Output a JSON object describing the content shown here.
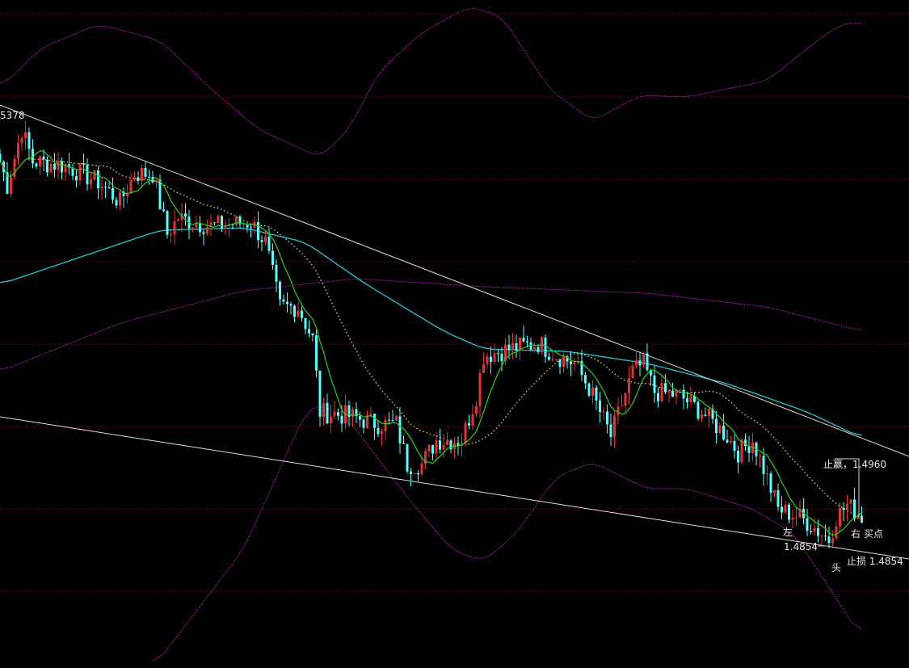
{
  "chart_data": {
    "type": "candlestick",
    "title": "",
    "xlabel": "",
    "ylabel": "",
    "xlim": [
      0,
      250
    ],
    "ylim": [
      1.4705,
      1.5532
    ],
    "grid": true,
    "grid_prices": [
      1.5515,
      1.5412,
      1.531,
      1.5208,
      1.5106,
      1.5004,
      1.4902,
      1.48
    ],
    "colors": {
      "up": "#e83030",
      "down": "#54ffff",
      "grid": "#7a1020",
      "fast_ma": "#1ed21e",
      "slow_ma": "#f0f060",
      "long_ma": "#20c8d8",
      "bands": "#c020c0",
      "trend": "#e0e0e0"
    },
    "close_path": [
      [
        0,
        1.5332
      ],
      [
        2,
        1.5302
      ],
      [
        6,
        1.5372
      ],
      [
        9,
        1.5332
      ],
      [
        18,
        1.5327
      ],
      [
        27,
        1.5307
      ],
      [
        33,
        1.5282
      ],
      [
        37,
        1.5317
      ],
      [
        42,
        1.5317
      ],
      [
        46,
        1.5242
      ],
      [
        49,
        1.5262
      ],
      [
        58,
        1.5252
      ],
      [
        69,
        1.5257
      ],
      [
        73,
        1.5232
      ],
      [
        77,
        1.5152
      ],
      [
        82,
        1.5152
      ],
      [
        86,
        1.5112
      ],
      [
        88,
        1.5022
      ],
      [
        96,
        1.5017
      ],
      [
        104,
        1.5007
      ],
      [
        109,
        1.5007
      ],
      [
        112,
        1.4957
      ],
      [
        116,
        1.4957
      ],
      [
        120,
        1.4987
      ],
      [
        127,
        1.4987
      ],
      [
        131,
        1.5042
      ],
      [
        133,
        1.5092
      ],
      [
        142,
        1.5102
      ],
      [
        148,
        1.5107
      ],
      [
        153,
        1.5092
      ],
      [
        158,
        1.5082
      ],
      [
        162,
        1.5052
      ],
      [
        166,
        1.5012
      ],
      [
        168,
        1.4992
      ],
      [
        171,
        1.5032
      ],
      [
        174,
        1.5072
      ],
      [
        177,
        1.5082
      ],
      [
        180,
        1.5047
      ],
      [
        187,
        1.5042
      ],
      [
        193,
        1.5022
      ],
      [
        200,
        1.4992
      ],
      [
        203,
        1.4972
      ],
      [
        207,
        1.4987
      ],
      [
        210,
        1.4952
      ],
      [
        214,
        1.4902
      ],
      [
        220,
        1.4892
      ],
      [
        223,
        1.4882
      ],
      [
        228,
        1.4864
      ],
      [
        230,
        1.4892
      ],
      [
        233,
        1.4907
      ],
      [
        237,
        1.4892
      ]
    ],
    "series": [
      {
        "name": "long_ma",
        "values": [
          [
            0,
            1.518
          ],
          [
            44,
            1.5247
          ],
          [
            67,
            1.525
          ],
          [
            84,
            1.5232
          ],
          [
            100,
            1.5182
          ],
          [
            122,
            1.5122
          ],
          [
            133,
            1.51
          ],
          [
            156,
            1.5097
          ],
          [
            178,
            1.5082
          ],
          [
            200,
            1.5057
          ],
          [
            222,
            1.5022
          ],
          [
            237,
            1.499
          ]
        ]
      },
      {
        "name": "band_upper",
        "values": [
          [
            0,
            1.5422
          ],
          [
            11,
            1.5472
          ],
          [
            27,
            1.5502
          ],
          [
            44,
            1.5482
          ],
          [
            58,
            1.5422
          ],
          [
            71,
            1.5372
          ],
          [
            88,
            1.5337
          ],
          [
            96,
            1.5372
          ],
          [
            104,
            1.5442
          ],
          [
            116,
            1.5492
          ],
          [
            129,
            1.5524
          ],
          [
            138,
            1.5512
          ],
          [
            151,
            1.5422
          ],
          [
            163,
            1.5382
          ],
          [
            176,
            1.5414
          ],
          [
            189,
            1.5412
          ],
          [
            211,
            1.5432
          ],
          [
            222,
            1.5472
          ],
          [
            231,
            1.5502
          ],
          [
            237,
            1.5504
          ]
        ]
      },
      {
        "name": "band_mid",
        "values": [
          [
            0,
            1.5072
          ],
          [
            33,
            1.5132
          ],
          [
            67,
            1.5172
          ],
          [
            98,
            1.5187
          ],
          [
            133,
            1.5177
          ],
          [
            178,
            1.5169
          ],
          [
            211,
            1.5152
          ],
          [
            237,
            1.5122
          ]
        ]
      },
      {
        "name": "band_lower",
        "values": [
          [
            42,
            1.4705
          ],
          [
            67,
            1.4852
          ],
          [
            84,
            1.5022
          ],
          [
            88,
            1.5032
          ],
          [
            96,
            1.5012
          ],
          [
            111,
            1.4922
          ],
          [
            124,
            1.4852
          ],
          [
            133,
            1.4837
          ],
          [
            142,
            1.4872
          ],
          [
            153,
            1.4942
          ],
          [
            163,
            1.496
          ],
          [
            171,
            1.4942
          ],
          [
            178,
            1.4927
          ],
          [
            189,
            1.4927
          ],
          [
            207,
            1.4902
          ],
          [
            218,
            1.4872
          ],
          [
            227,
            1.4812
          ],
          [
            237,
            1.4742
          ]
        ]
      },
      {
        "name": "trend_upper",
        "values": [
          [
            0,
            1.5402
          ],
          [
            250,
            1.4967
          ]
        ]
      },
      {
        "name": "trend_lower",
        "values": [
          [
            0,
            1.5016
          ],
          [
            250,
            1.484
          ]
        ]
      }
    ],
    "annotations": {
      "top_price": "5378",
      "take_profit": "止赢，1.4960",
      "left": "左",
      "left_price": "1.4854",
      "head": "头",
      "right": "右",
      "buy_point": "买点",
      "stop_loss": "止损 1.4854"
    }
  }
}
